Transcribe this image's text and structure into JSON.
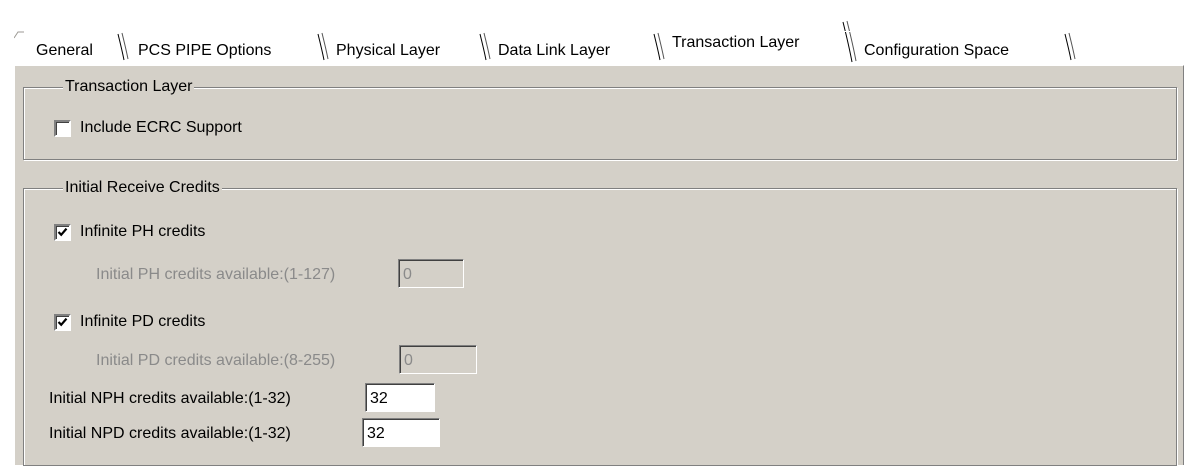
{
  "tabs": [
    {
      "label": "General",
      "active": false
    },
    {
      "label": "PCS PIPE Options",
      "active": false
    },
    {
      "label": "Physical Layer",
      "active": false
    },
    {
      "label": "Data Link Layer",
      "active": false
    },
    {
      "label": "Transaction Layer",
      "active": true
    },
    {
      "label": "Configuration Space",
      "active": false
    }
  ],
  "transaction_group": {
    "legend": "Transaction Layer",
    "ecrc": {
      "label": "Include ECRC Support",
      "checked": false
    }
  },
  "credits_group": {
    "legend": "Initial Receive Credits",
    "infinite_ph": {
      "label": "Infinite PH credits",
      "checked": true
    },
    "ph_credits": {
      "label": "Initial PH credits available:(1-127)",
      "value": "0",
      "enabled": false
    },
    "infinite_pd": {
      "label": "Infinite PD credits",
      "checked": true
    },
    "pd_credits": {
      "label": "Initial PD credits available:(8-255)",
      "value": "0",
      "enabled": false
    },
    "nph_credits": {
      "label": "Initial NPH credits available:(1-32)",
      "value": "32",
      "enabled": true
    },
    "npd_credits": {
      "label": "Initial NPD credits available:(1-32)",
      "value": "32",
      "enabled": true
    }
  },
  "colors": {
    "panel_background": "#d4d0c8",
    "disabled_text": "#8a8a8a",
    "field_background": "#ffffff"
  }
}
